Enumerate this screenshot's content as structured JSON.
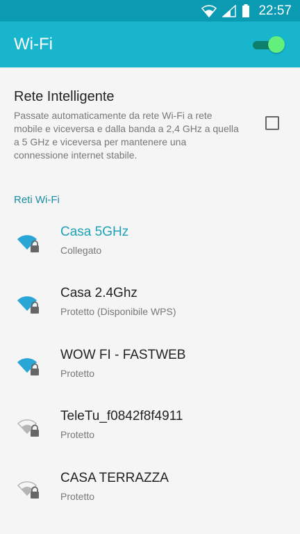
{
  "status_bar": {
    "time": "22:57",
    "icons": [
      "wifi-icon",
      "signal-icon",
      "battery-icon"
    ]
  },
  "app_bar": {
    "title": "Wi-Fi",
    "toggle_on": true
  },
  "smart_network": {
    "title": "Rete Intelligente",
    "description": "Passate automaticamente da rete Wi-Fi a rete mobile e viceversa e dalla banda a 2,4 GHz a quella a 5 GHz e viceversa per mantenere una connessione internet stabile.",
    "checked": false
  },
  "section_header": "Reti Wi-Fi",
  "networks": [
    {
      "name": "Casa 5GHz",
      "status": "Collegato",
      "connected": true,
      "signal": "full",
      "locked": true
    },
    {
      "name": "Casa 2.4Ghz",
      "status": "Protetto (Disponibile WPS)",
      "connected": false,
      "signal": "full",
      "locked": true
    },
    {
      "name": "WOW FI - FASTWEB",
      "status": "Protetto",
      "connected": false,
      "signal": "full",
      "locked": true
    },
    {
      "name": "TeleTu_f0842f8f4911",
      "status": "Protetto",
      "connected": false,
      "signal": "weak",
      "locked": true
    },
    {
      "name": "CASA TERRAZZA",
      "status": "Protetto",
      "connected": false,
      "signal": "weak",
      "locked": true
    }
  ],
  "colors": {
    "status_bar": "#0a9ab2",
    "app_bar": "#18b5cd",
    "accent": "#1a8ca3",
    "connected_name": "#1ea1b8",
    "wifi_strong": "#2aa6d6",
    "wifi_weak": "#b5b5b5",
    "toggle_thumb": "#63ef7c"
  }
}
